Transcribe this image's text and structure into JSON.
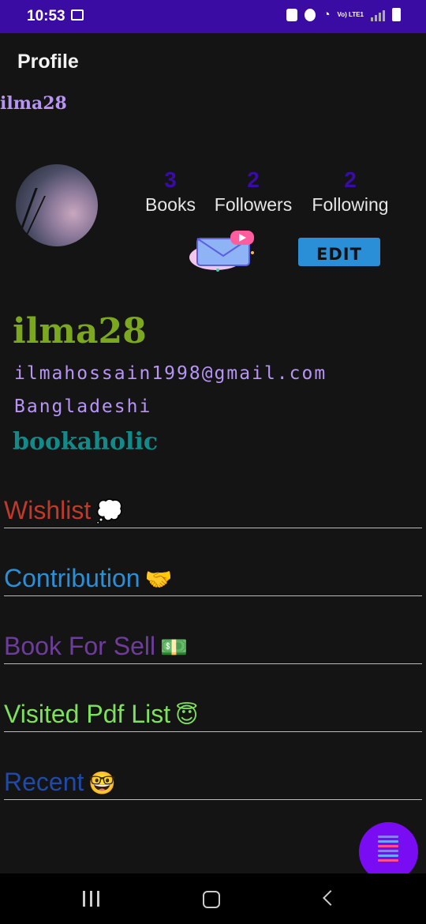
{
  "status_bar": {
    "time": "10:53",
    "network": "Vo) LTE1"
  },
  "header": {
    "title": "Profile",
    "username": "ilma28"
  },
  "stats": [
    {
      "value": "3",
      "label": "Books"
    },
    {
      "value": "2",
      "label": "Followers"
    },
    {
      "value": "2",
      "label": "Following"
    }
  ],
  "actions": {
    "edit_label": "EDIT",
    "message_icon": "envelope-message-icon"
  },
  "profile": {
    "name": "ilma28",
    "email": "ilmahossain1998@gmail.com",
    "country": "Bangladeshi",
    "bio": "bookaholic"
  },
  "menu": [
    {
      "label": "Wishlist",
      "emoji": "💭",
      "color": "#c0392b"
    },
    {
      "label": "Contribution",
      "emoji": "🤝",
      "color": "#2a8fd6"
    },
    {
      "label": "Book For Sell",
      "emoji": "💵",
      "color": "#6e3d9b"
    },
    {
      "label": "Visited Pdf List",
      "emoji": "😇",
      "color": "#7ee05b"
    },
    {
      "label": "Recent",
      "emoji": "🤓",
      "color": "#1f4aa8"
    }
  ],
  "colors": {
    "status_bar": "#3a0ca3",
    "fab": "#7a0cf3",
    "accent_purple": "#b794f6"
  }
}
